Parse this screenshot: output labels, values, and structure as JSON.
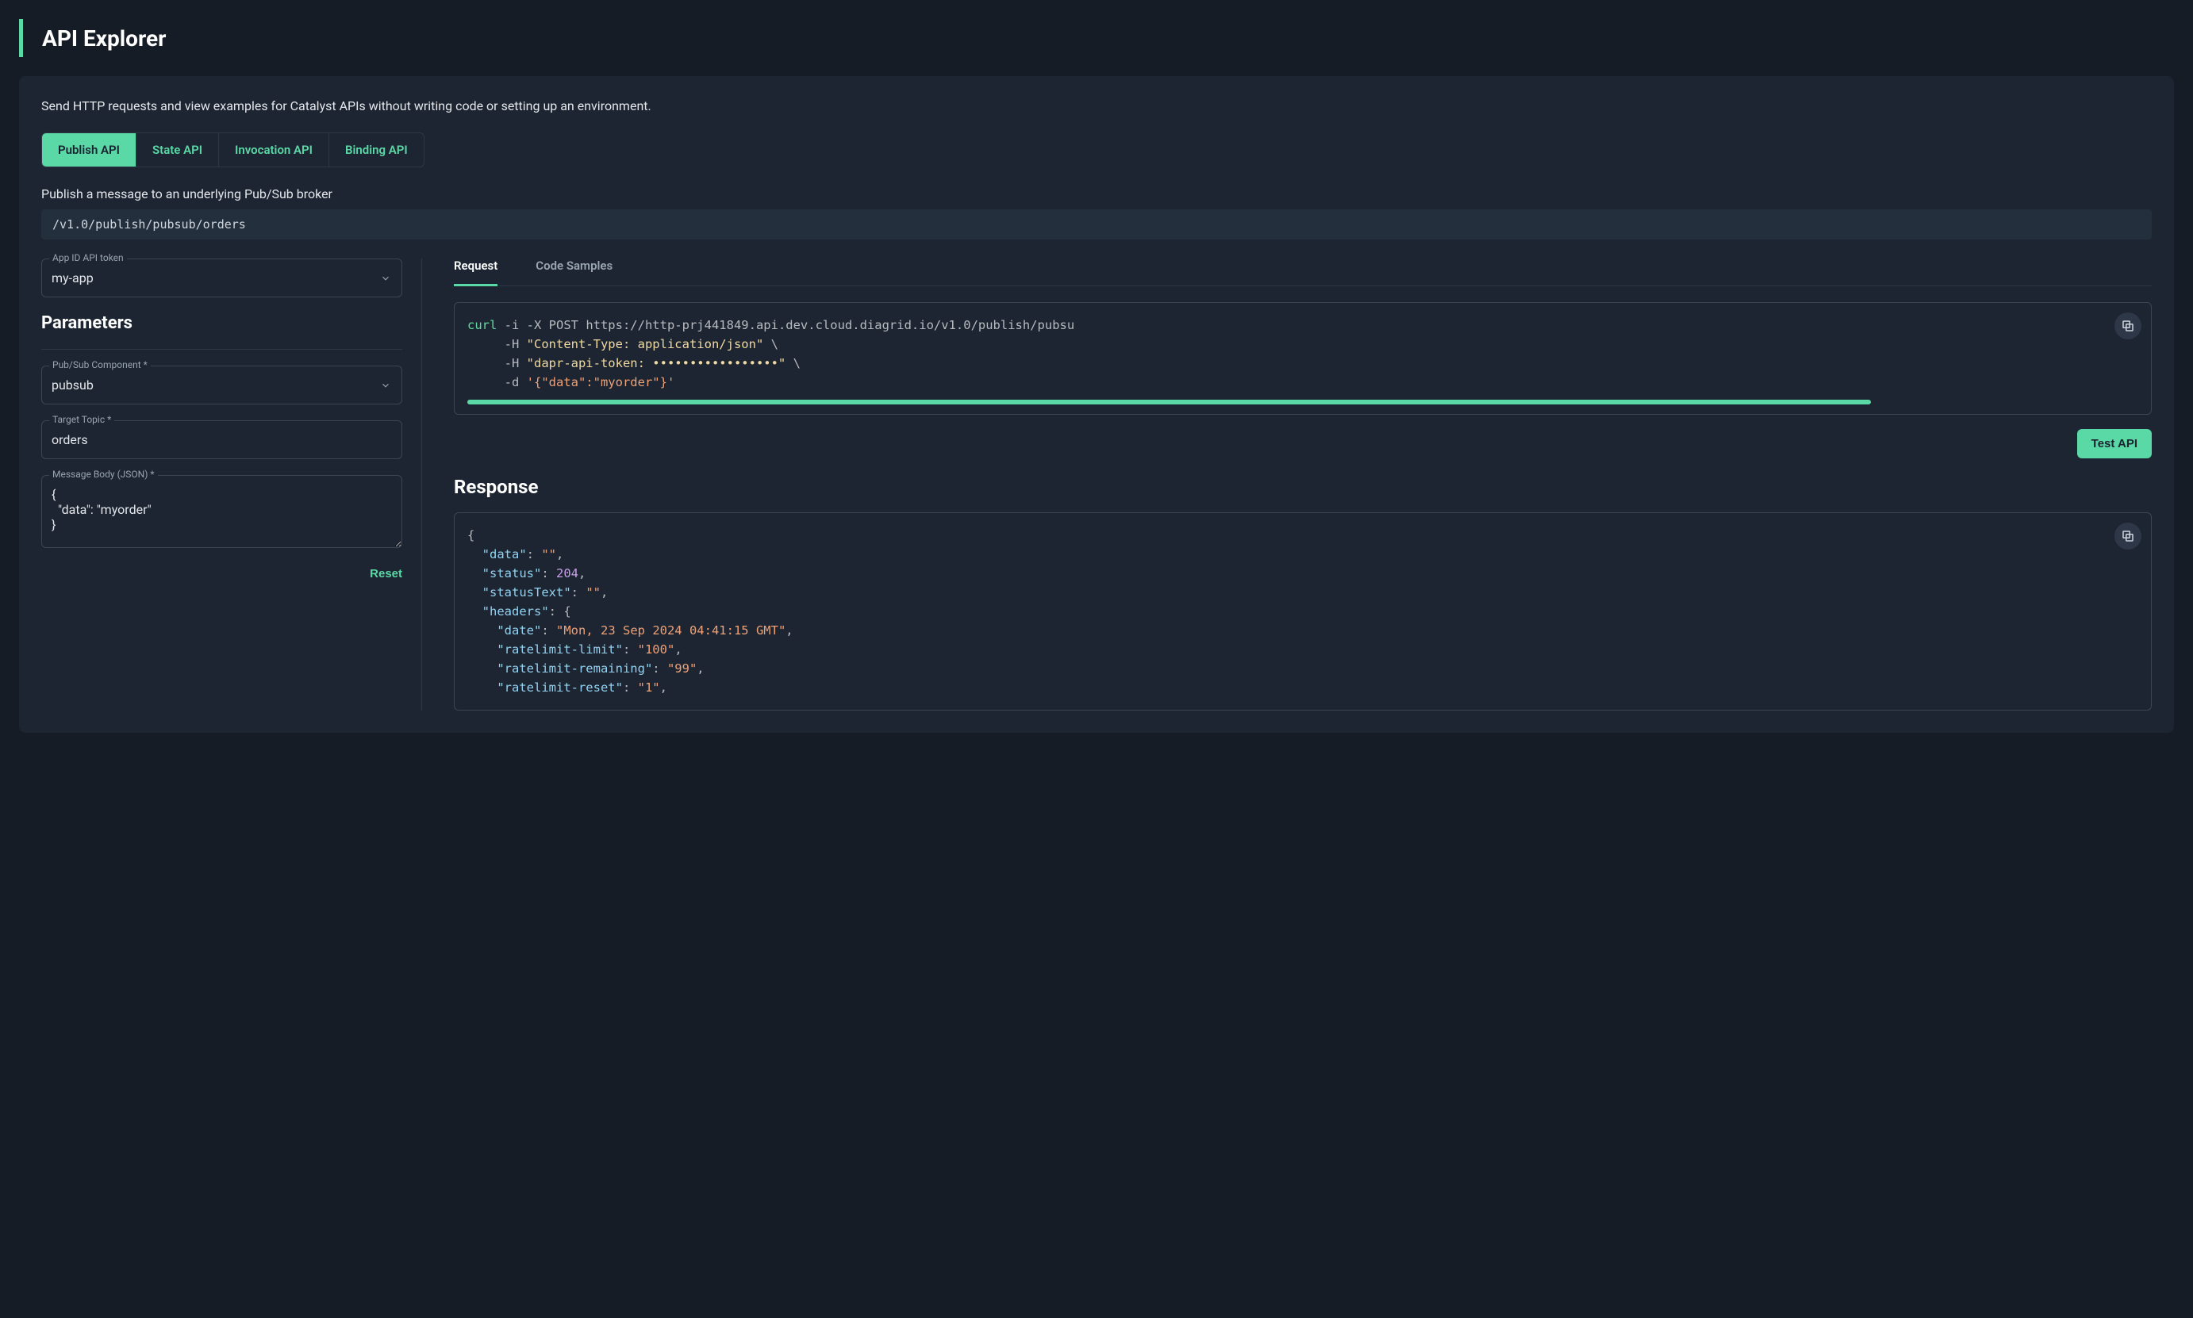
{
  "header": {
    "title": "API Explorer"
  },
  "description": "Send HTTP requests and view examples for Catalyst APIs without writing code or setting up an environment.",
  "api_tabs": [
    {
      "label": "Publish API",
      "active": true
    },
    {
      "label": "State API",
      "active": false
    },
    {
      "label": "Invocation API",
      "active": false
    },
    {
      "label": "Binding API",
      "active": false
    }
  ],
  "tab_description": "Publish a message to an underlying Pub/Sub broker",
  "endpoint": "/v1.0/publish/pubsub/orders",
  "app_token": {
    "label": "App ID API token",
    "value": "my-app"
  },
  "parameters": {
    "title": "Parameters",
    "component": {
      "label": "Pub/Sub Component *",
      "value": "pubsub"
    },
    "topic": {
      "label": "Target Topic *",
      "value": "orders"
    },
    "body": {
      "label": "Message Body (JSON) *",
      "value": "{\n  \"data\": \"myorder\"\n}"
    },
    "reset": "Reset"
  },
  "right": {
    "sub_tabs": [
      {
        "label": "Request",
        "active": true
      },
      {
        "label": "Code Samples",
        "active": false
      }
    ],
    "test_button": "Test API",
    "response_title": "Response"
  },
  "request_code": {
    "cmd": "curl",
    "flags1": " -i -X POST ",
    "url": "https://http-prj441849.api.dev.cloud.diagrid.io/v1.0/publish/pubsu",
    "h1": "     -H ",
    "h1v": "\"Content-Type: application/json\"",
    "cont": " \\",
    "h2": "     -H ",
    "h2v": "\"dapr-api-token: •••••••••••••••••\"",
    "d": "     -d ",
    "dv": "'{\"data\":\"myorder\"}'"
  },
  "response_code": {
    "open": "{",
    "k_data": "\"data\"",
    "v_data": "\"\"",
    "k_status": "\"status\"",
    "v_status": "204",
    "k_statusText": "\"statusText\"",
    "v_statusText": "\"\"",
    "k_headers": "\"headers\"",
    "k_date": "\"date\"",
    "v_date": "\"Mon, 23 Sep 2024 04:41:15 GMT\"",
    "k_rl_limit": "\"ratelimit-limit\"",
    "v_rl_limit": "\"100\"",
    "k_rl_remaining": "\"ratelimit-remaining\"",
    "v_rl_remaining": "\"99\"",
    "k_rl_reset": "\"ratelimit-reset\"",
    "v_rl_reset": "\"1\""
  }
}
